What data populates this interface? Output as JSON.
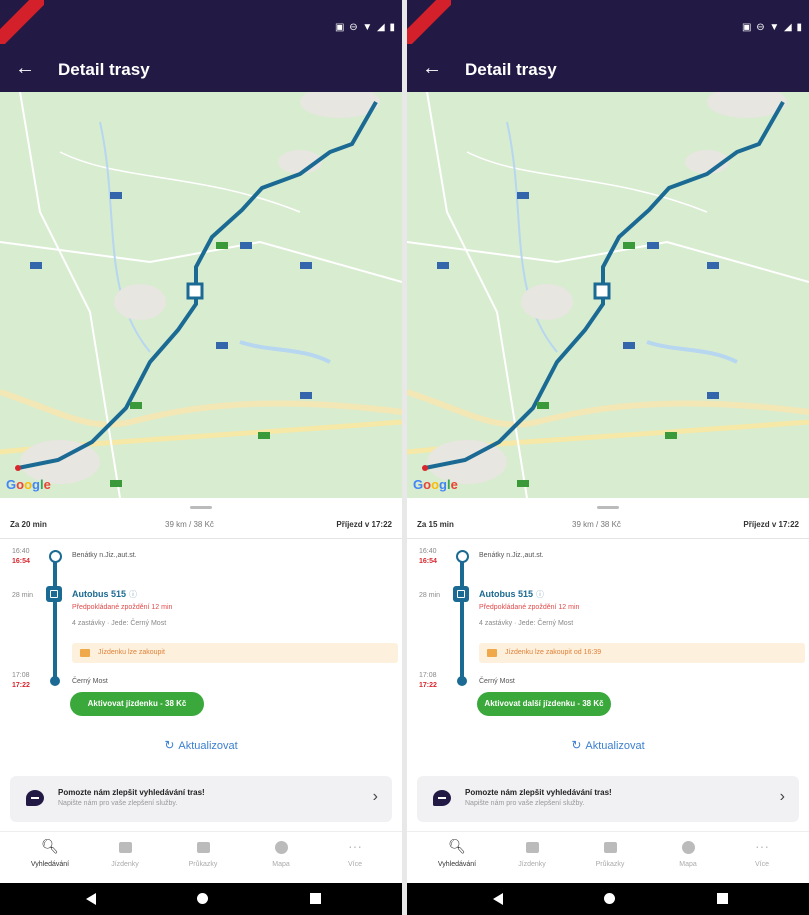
{
  "colors": {
    "appbar": "#221a44",
    "route": "#1b6a93",
    "buy_button": "#3aa83a",
    "delay_red": "#d8262c",
    "link_blue": "#3b7fcf",
    "map_green": "#d8ecd0"
  },
  "appbar": {
    "title": "Detail trasy"
  },
  "map": {
    "attribution": "Google"
  },
  "screens": [
    {
      "summary": {
        "duration": "Za 20 min",
        "mid": "39 km / 38 Kč",
        "arrival": "Příjezd v 17:22"
      },
      "timeline": {
        "start_time": "16:40",
        "start_time_actual": "16:54",
        "start_stop": "Benátky n.Jiz.,aut.st.",
        "duration": "28 min",
        "line": "Autobus 515",
        "line_icon": "ⓘ",
        "delay": "Předpokládané zpoždění 12 min",
        "stops": "4 zastávky · Jede: Černý Most",
        "notice": "Jízdenku lze zakoupit",
        "end_time": "17:08",
        "end_time_actual": "17:22",
        "end_stop": "Černý Most"
      },
      "buy_button": "Aktivovat jízdenku - 38 Kč",
      "refresh": "Aktualizovat",
      "feedback": {
        "title": "Pomozte nám zlepšit vyhledávání tras!",
        "subtitle": "Napište nám pro vaše zlepšení služby."
      }
    },
    {
      "summary": {
        "duration": "Za 15 min",
        "mid": "39 km / 38 Kč",
        "arrival": "Příjezd v 17:22"
      },
      "timeline": {
        "start_time": "16:40",
        "start_time_actual": "16:54",
        "start_stop": "Benátky n.Jiz.,aut.st.",
        "duration": "28 min",
        "line": "Autobus 515",
        "line_icon": "ⓘ",
        "delay": "Předpokládané zpoždění 12 min",
        "stops": "4 zastávky · Jede: Černý Most",
        "notice": "Jízdenku lze zakoupit od 16:39",
        "end_time": "17:08",
        "end_time_actual": "17:22",
        "end_stop": "Černý Most"
      },
      "buy_button": "Aktivovat další jízdenku - 38 Kč",
      "refresh": "Aktualizovat",
      "feedback": {
        "title": "Pomozte nám zlepšit vyhledávání tras!",
        "subtitle": "Napište nám pro vaše zlepšení služby."
      }
    }
  ],
  "bottom_nav": [
    {
      "label": "Vyhledávání",
      "icon": "search-icon"
    },
    {
      "label": "Jízdenky",
      "icon": "ticket-icon"
    },
    {
      "label": "Průkazky",
      "icon": "card-icon"
    },
    {
      "label": "Mapa",
      "icon": "compass-icon"
    },
    {
      "label": "Více",
      "icon": "more-icon"
    }
  ]
}
